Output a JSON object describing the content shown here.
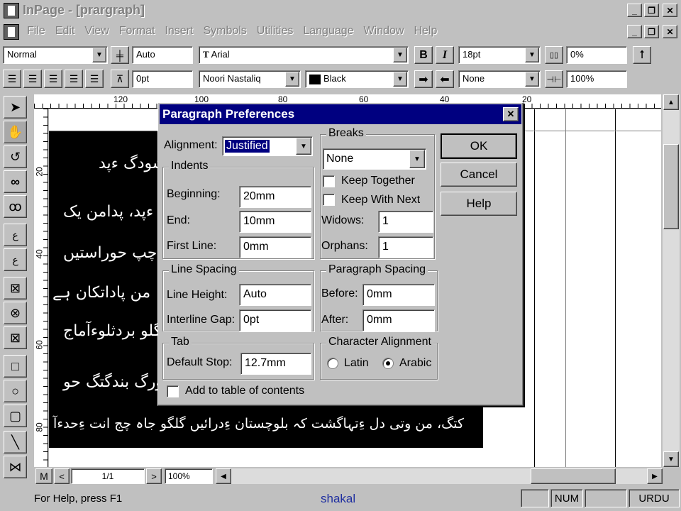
{
  "app": {
    "title": "InPage - [prargraph]"
  },
  "menu": [
    "File",
    "Edit",
    "View",
    "Format",
    "Insert",
    "Symbols",
    "Utilities",
    "Language",
    "Window",
    "Help"
  ],
  "toolbar1": {
    "style": "Normal",
    "leading": "Auto",
    "font": "Arial",
    "bold": "B",
    "italic": "I",
    "size": "18pt",
    "tracking": "0%"
  },
  "toolbar2": {
    "indent": "0pt",
    "urdu_font": "Noori Nastaliq",
    "color": "Black",
    "shade": "None",
    "scale": "100%"
  },
  "ruler": {
    "ticks": [
      "120",
      "100",
      "80",
      "60",
      "40",
      "20"
    ],
    "vticks": [
      "20",
      "40",
      "60",
      "80"
    ]
  },
  "dialog": {
    "title": "Paragraph Preferences",
    "alignment_label": "Alignment:",
    "alignment_value": "Justified",
    "indents": {
      "title": "Indents",
      "beginning_label": "Beginning:",
      "beginning": "20mm",
      "end_label": "End:",
      "end": "10mm",
      "firstline_label": "First Line:",
      "firstline": "0mm"
    },
    "breaks": {
      "title": "Breaks",
      "value": "None",
      "keep_together": "Keep Together",
      "keep_with_next": "Keep With Next",
      "widows_label": "Widows:",
      "widows": "1",
      "orphans_label": "Orphans:",
      "orphans": "1"
    },
    "line_spacing": {
      "title": "Line Spacing",
      "height_label": "Line Height:",
      "height": "Auto",
      "gap_label": "Interline Gap:",
      "gap": "0pt"
    },
    "para_spacing": {
      "title": "Paragraph Spacing",
      "before_label": "Before:",
      "before": "0mm",
      "after_label": "After:",
      "after": "0mm"
    },
    "tab": {
      "title": "Tab",
      "default_label": "Default Stop:",
      "default": "12.7mm"
    },
    "char_align": {
      "title": "Character Alignment",
      "latin": "Latin",
      "arabic": "Arabic"
    },
    "toc": "Add to table of contents",
    "ok": "OK",
    "cancel": "Cancel",
    "help": "Help"
  },
  "urdu_lines": [
    "حودیماشودگ ءپد",
    "ی ءپد، پدامن یک",
    "ءچپ حوراستیں",
    "من پاداتکان ہے",
    "گلو بردثلوءآماج",
    "ءورگ بندگتگ حو",
    "کتگ، من وتی دل ءِتہاگشت کہ بلوچستان ءِدرائیں گلگو جاہ چج انت ءِحدءآ"
  ],
  "bottom": {
    "m": "M",
    "page": "1/1",
    "zoom": "100%"
  },
  "status": {
    "help": "For Help, press F1",
    "user": "shakal",
    "num": "NUM",
    "lang": "URDU"
  }
}
